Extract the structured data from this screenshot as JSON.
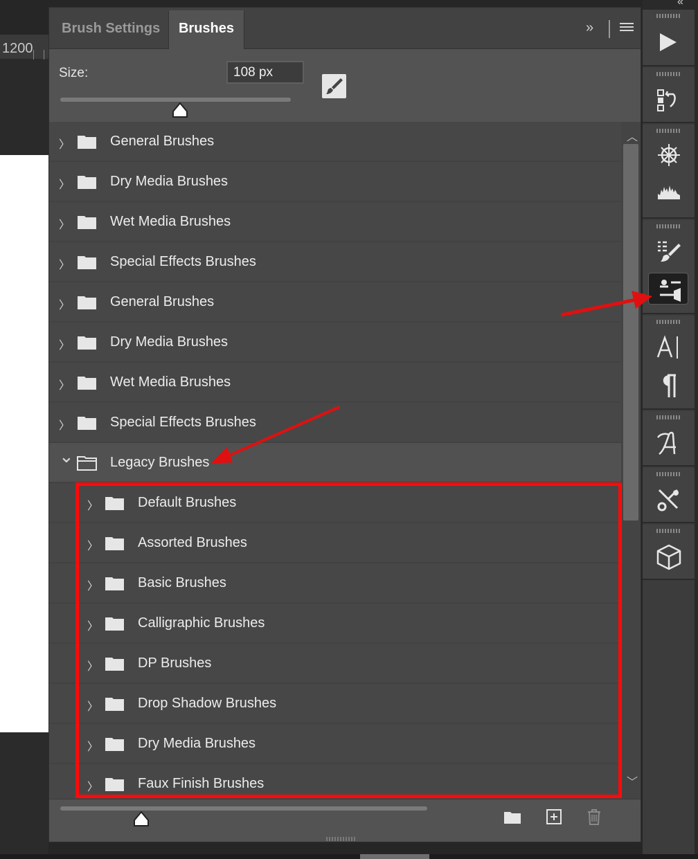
{
  "ruler": {
    "value": "1200"
  },
  "panel": {
    "tabs": [
      {
        "label": "Brush Settings",
        "active": false
      },
      {
        "label": "Brushes",
        "active": true
      }
    ],
    "expand_glyph": "»",
    "size_label": "Size:",
    "size_value": "108 px",
    "size_slider_level": 0.52
  },
  "brush_groups": [
    {
      "label": "General Brushes",
      "expanded": false,
      "level": 0
    },
    {
      "label": "Dry Media Brushes",
      "expanded": false,
      "level": 0
    },
    {
      "label": "Wet Media Brushes",
      "expanded": false,
      "level": 0
    },
    {
      "label": "Special Effects Brushes",
      "expanded": false,
      "level": 0
    },
    {
      "label": "General Brushes",
      "expanded": false,
      "level": 0
    },
    {
      "label": "Dry Media Brushes",
      "expanded": false,
      "level": 0
    },
    {
      "label": "Wet Media Brushes",
      "expanded": false,
      "level": 0
    },
    {
      "label": "Special Effects Brushes",
      "expanded": false,
      "level": 0
    },
    {
      "label": "Legacy Brushes",
      "expanded": true,
      "level": 0
    },
    {
      "label": "Default Brushes",
      "expanded": false,
      "level": 1
    },
    {
      "label": "Assorted Brushes",
      "expanded": false,
      "level": 1
    },
    {
      "label": "Basic Brushes",
      "expanded": false,
      "level": 1
    },
    {
      "label": "Calligraphic Brushes",
      "expanded": false,
      "level": 1
    },
    {
      "label": "DP Brushes",
      "expanded": false,
      "level": 1
    },
    {
      "label": "Drop Shadow Brushes",
      "expanded": false,
      "level": 1
    },
    {
      "label": "Dry Media Brushes",
      "expanded": false,
      "level": 1
    },
    {
      "label": "Faux Finish Brushes",
      "expanded": false,
      "level": 1
    }
  ],
  "footer": {
    "preview_slider_level": 0.22,
    "icons": [
      "new-group-folder-icon",
      "new-brush-icon",
      "trash-icon"
    ]
  },
  "dock": {
    "collapse_glyph": "«",
    "icons": [
      "play-icon",
      "history-icon",
      "navigator-icon",
      "histogram-icon",
      "brush-presets-icon",
      "brushes-panel-icon",
      "character-icon",
      "paragraph-icon",
      "glyphs-icon",
      "tools-icon",
      "3d-icon"
    ],
    "active_icon": "brushes-panel-icon"
  },
  "colors": {
    "panel_bg": "#535353",
    "list_bg": "#474747",
    "highlight": "#ff0a0a",
    "arrow": "#e01010"
  }
}
